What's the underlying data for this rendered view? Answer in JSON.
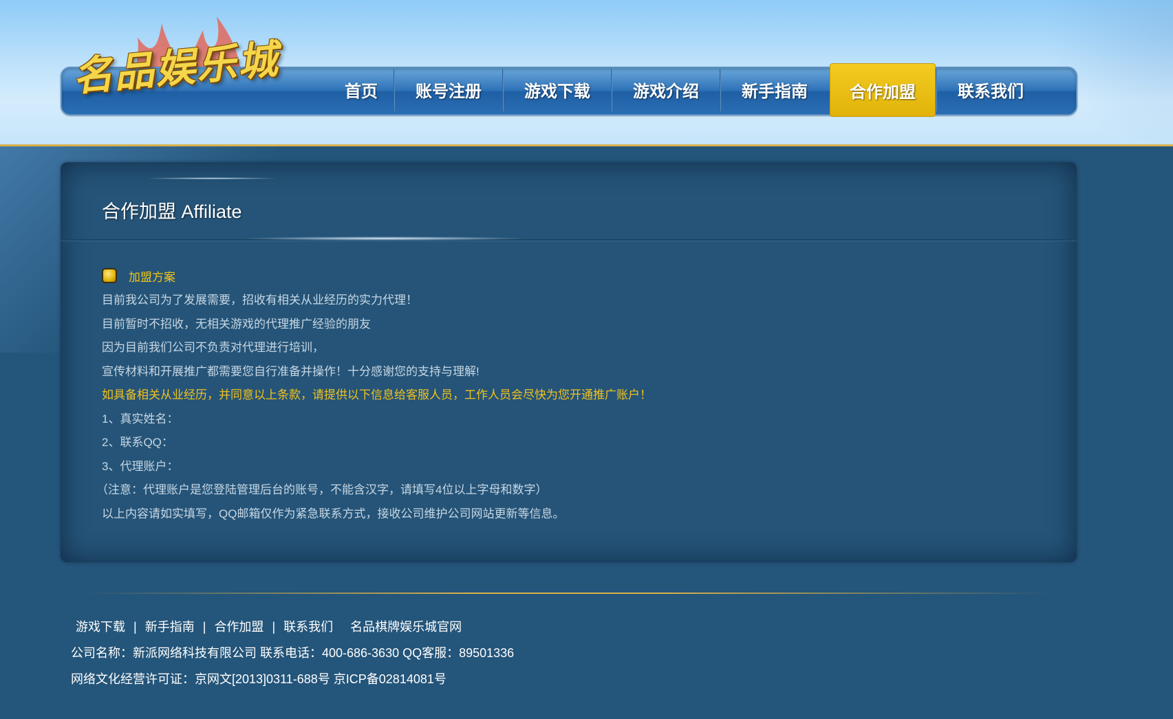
{
  "logo": {
    "text": "名品娱乐城"
  },
  "nav": {
    "items": [
      {
        "label": "首页",
        "active": false
      },
      {
        "label": "账号注册",
        "active": false
      },
      {
        "label": "游戏下载",
        "active": false
      },
      {
        "label": "游戏介绍",
        "active": false
      },
      {
        "label": "新手指南",
        "active": false
      },
      {
        "label": "合作加盟",
        "active": true
      },
      {
        "label": "联系我们",
        "active": false
      }
    ]
  },
  "panel": {
    "title": "合作加盟 Affiliate",
    "section_heading": "加盟方案",
    "lines": [
      "目前我公司为了发展需要，招收有相关从业经历的实力代理！",
      "目前暂时不招收，无相关游戏的代理推广经验的朋友",
      "因为目前我们公司不负责对代理进行培训，",
      "宣传材料和开展推广都需要您自行准备并操作！十分感谢您的支持与理解!",
      "如具备相关从业经历，并同意以上条款，请提供以下信息给客服人员，工作人员会尽快为您开通推广账户！",
      "1、真实姓名：",
      "2、联系QQ：",
      "3、代理账户：",
      "（注意：代理账户是您登陆管理后台的账号，不能含汉字，请填写4位以上字母和数字）",
      "以上内容请如实填写，QQ邮箱仅作为紧急联系方式，接收公司维护公司网站更新等信息。"
    ]
  },
  "footer": {
    "links": [
      "游戏下载",
      "新手指南",
      "合作加盟",
      "联系我们"
    ],
    "separator": "|",
    "site_name": "名品棋牌娱乐城官网",
    "company_line": "公司名称：新派网络科技有限公司 联系电话：400-686-3630 QQ客服：89501336",
    "license_line": "网络文化经营许可证：京网文[2013]0311-688号 京ICP备02814081号"
  },
  "colors": {
    "page_bg": "#24557a",
    "nav_active": "#e8bb10",
    "highlight_text": "#f2c21c",
    "body_text": "#c7d7e4"
  }
}
